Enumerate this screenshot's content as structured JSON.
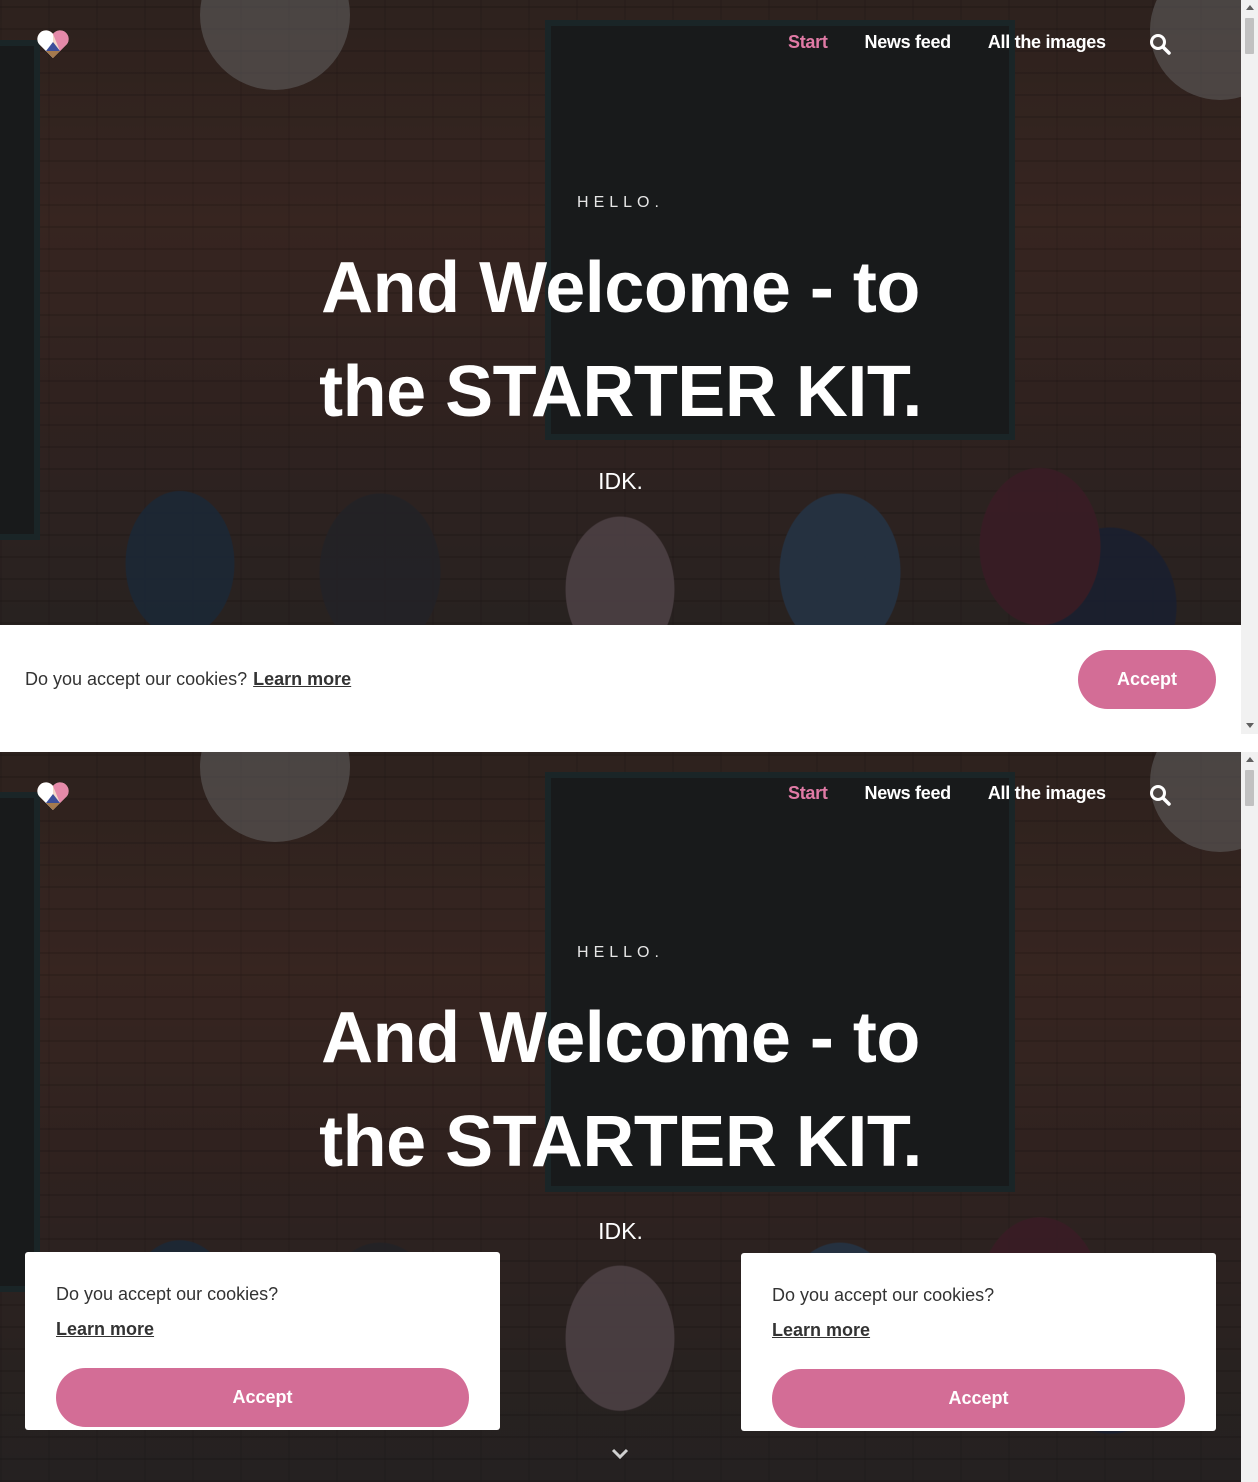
{
  "nav": {
    "items": [
      {
        "label": "Start",
        "active": true
      },
      {
        "label": "News feed",
        "active": false
      },
      {
        "label": "All the images",
        "active": false
      }
    ],
    "search_icon": "search-icon",
    "logo_icon": "heart-logo-icon"
  },
  "hero": {
    "eyebrow": "HELLO.",
    "headline_line1": "And Welcome - to",
    "headline_line2": "the STARTER KIT.",
    "subtitle": "IDK."
  },
  "cookie_bar": {
    "text": "Do you accept our cookies?",
    "learn_more": "Learn more",
    "accept": "Accept"
  },
  "cookie_card_left": {
    "text": "Do you accept our cookies?",
    "learn_more": "Learn more",
    "accept": "Accept"
  },
  "cookie_card_right": {
    "text": "Do you accept our cookies?",
    "learn_more": "Learn more",
    "accept": "Accept"
  },
  "colors": {
    "accent": "#d36d96",
    "active_nav": "#e07aa5"
  }
}
